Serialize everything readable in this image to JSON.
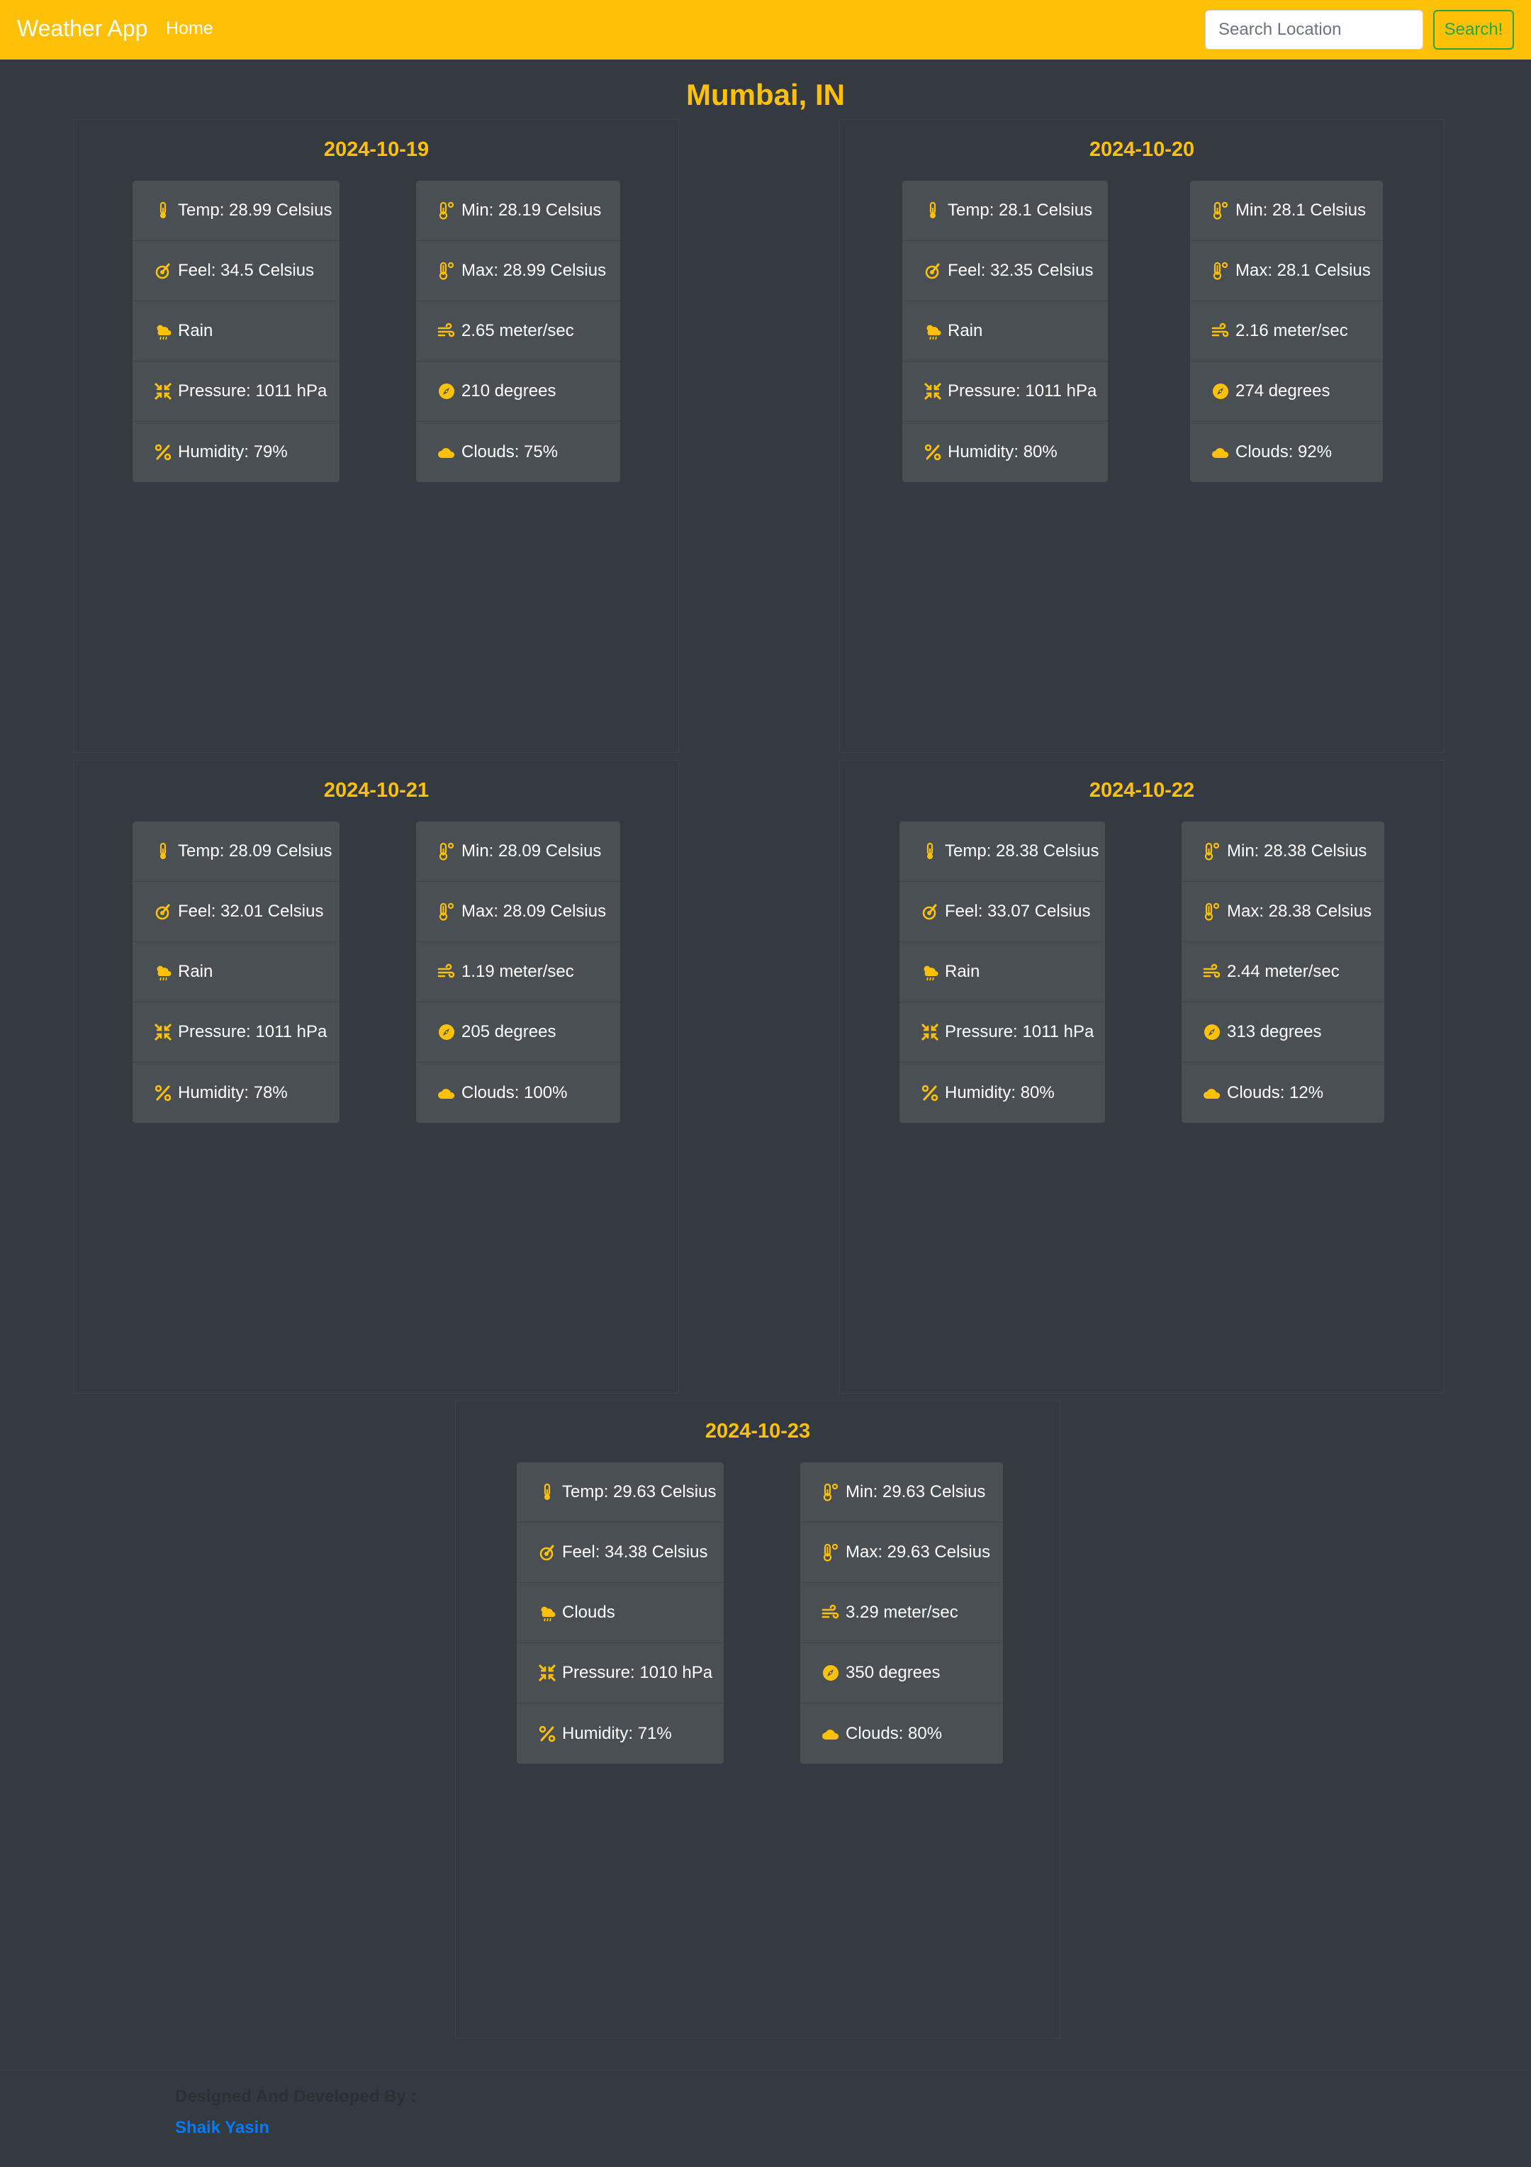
{
  "navbar": {
    "brand": "Weather App",
    "home_link": "Home",
    "search_placeholder": "Search Location",
    "search_button": "Search!"
  },
  "city": "Mumbai, IN",
  "days": [
    {
      "date": "2024-10-19",
      "temp": "Temp: 28.99 Celsius",
      "feel": "Feel: 34.5 Celsius",
      "condition": "Rain",
      "pressure": "Pressure: 1011 hPa",
      "humidity": "Humidity: 79%",
      "min": "Min: 28.19 Celsius",
      "max": "Max: 28.99 Celsius",
      "wind": "2.65 meter/sec",
      "direction": "210 degrees",
      "clouds": "Clouds: 75%"
    },
    {
      "date": "2024-10-20",
      "temp": "Temp: 28.1 Celsius",
      "feel": "Feel: 32.35 Celsius",
      "condition": "Rain",
      "pressure": "Pressure: 1011 hPa",
      "humidity": "Humidity: 80%",
      "min": "Min: 28.1 Celsius",
      "max": "Max: 28.1 Celsius",
      "wind": "2.16 meter/sec",
      "direction": "274 degrees",
      "clouds": "Clouds: 92%"
    },
    {
      "date": "2024-10-21",
      "temp": "Temp: 28.09 Celsius",
      "feel": "Feel: 32.01 Celsius",
      "condition": "Rain",
      "pressure": "Pressure: 1011 hPa",
      "humidity": "Humidity: 78%",
      "min": "Min: 28.09 Celsius",
      "max": "Max: 28.09 Celsius",
      "wind": "1.19 meter/sec",
      "direction": "205 degrees",
      "clouds": "Clouds: 100%"
    },
    {
      "date": "2024-10-22",
      "temp": "Temp: 28.38 Celsius",
      "feel": "Feel: 33.07 Celsius",
      "condition": "Rain",
      "pressure": "Pressure: 1011 hPa",
      "humidity": "Humidity: 80%",
      "min": "Min: 28.38 Celsius",
      "max": "Max: 28.38 Celsius",
      "wind": "2.44 meter/sec",
      "direction": "313 degrees",
      "clouds": "Clouds: 12%"
    },
    {
      "date": "2024-10-23",
      "temp": "Temp: 29.63 Celsius",
      "feel": "Feel: 34.38 Celsius",
      "condition": "Clouds",
      "pressure": "Pressure: 1010 hPa",
      "humidity": "Humidity: 71%",
      "min": "Min: 29.63 Celsius",
      "max": "Max: 29.63 Celsius",
      "wind": "3.29 meter/sec",
      "direction": "350 degrees",
      "clouds": "Clouds: 80%"
    }
  ],
  "icons": {
    "temp": "thermometer-icon",
    "feel": "feel-icon",
    "condition": "sun-rain-icon",
    "pressure": "pressure-icon",
    "humidity": "percent-icon",
    "min": "thermometer-degree-icon",
    "max": "thermometer-degree-icon",
    "wind": "wind-icon",
    "direction": "compass-icon",
    "clouds": "cloud-icon"
  },
  "accent_color": "#ffc107",
  "footer": {
    "label": "Designed And Developed By :",
    "author": "Shaik Yasin"
  }
}
